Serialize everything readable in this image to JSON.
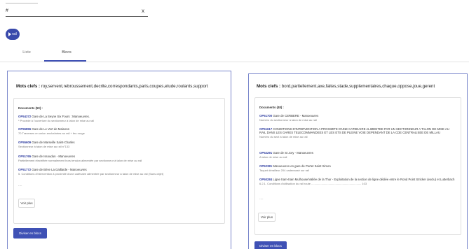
{
  "search": {
    "value": "#",
    "clear_icon": "x"
  },
  "chip": {
    "label": "rail",
    "icon": "play-icon"
  },
  "tabs": [
    {
      "label": "Liste"
    },
    {
      "label": "Blocs"
    }
  ],
  "colors": {
    "accent": "#3f51b5",
    "card_border": "#7986cb",
    "doc_id": "#2e3da0"
  },
  "left_card": {
    "keywords_label": "Mots clefs :",
    "keywords": "roy,servent,rebroussement,decrite,correspondants,paris,coupes,etude,roulants,support",
    "docs_count": "Documents (50) :",
    "docs": [
      {
        "id": "OP54372",
        "title": " Gare de La Seyne Six Fours : Manoeuvres.",
        "snippet": "* Procède à l'ouverture du sectionneur à talon de mise au rail"
      },
      {
        "id": "OP55896",
        "title": " Gare de Le Vert de Maisons",
        "snippet": "70 Traverses en union enchaînées au rail + feu rouge"
      },
      {
        "id": "OP55609",
        "title": " Gare de Marseille Saint-Charles",
        "snippet": "Sectionneur à talon de mise au rail n°133"
      },
      {
        "id": "OP51765",
        "title": " Gare de Issoudun - Manoeuvres",
        "snippet": "Partiellement électrifiée normalement hors tension alimentée par sectionneur à talon de mise au rail"
      },
      {
        "id": "OP51772",
        "title": " Gare de Brive La Gaillarde - Manoeuvres",
        "snippet": "5. Conditions d'intervention à proximité d'une caténaire alimentée par sectionneur à talon de mise au rail (Sans objet)"
      }
    ],
    "ellipsis": "....",
    "voir_plus": "Voir plus",
    "diviser": "Diviser en blocs"
  },
  "right_card": {
    "keywords_label": "Mots clefs :",
    "keywords": "bord,partiellement,axe,faites,stade,supplementaires,chaque,oppose,joue,gerent",
    "docs_count": "Documents (48) :",
    "docs": [
      {
        "id": "OP51700",
        "title": " Gare de CERBERE - Manoeuvres",
        "snippet": "Numéro du sectionneur à talon de mise au rail"
      },
      {
        "id": "OP51617",
        "title": " CONDITIONS D'INTERVENTION A PROXIMITE D'UNE CATENAIRE ALIMENTEE PAR UN SECTIONNEUR A TALON DE MISE AU RAIL DANS LES GARES TELECOMMANDEES ET LES ETS DE PLEINE VOIE DEPENDANT DE LA CDE CENTRALISEE DE MILLAU",
        "snippet": "Numéro du sect à talon de mise au rail"
      },
      {
        "id": "OP52291",
        "title": " Gare de St Jory - Manoeuvres",
        "snippet": "A talon de mise au rail"
      },
      {
        "id": "OP52381",
        "title": " Manoeuvres en gare de Portet Saint Simon",
        "snippet": "Taquet dérailleur 204 cadenassé sur rail"
      },
      {
        "id": "OP50284",
        "title": " Ligne tram-train Mulhouse/Vallée de la Thur - Exploitation de la section de ligne dédiée entre le Rond Point Stricker (exclu) et Lutterbach",
        "snippet": "6.2.1. Conditions d'utilisation du rail route ................................................................ 103"
      }
    ],
    "ellipsis": "....",
    "voir_plus": "Voir plus",
    "diviser": "Diviser en blocs"
  }
}
